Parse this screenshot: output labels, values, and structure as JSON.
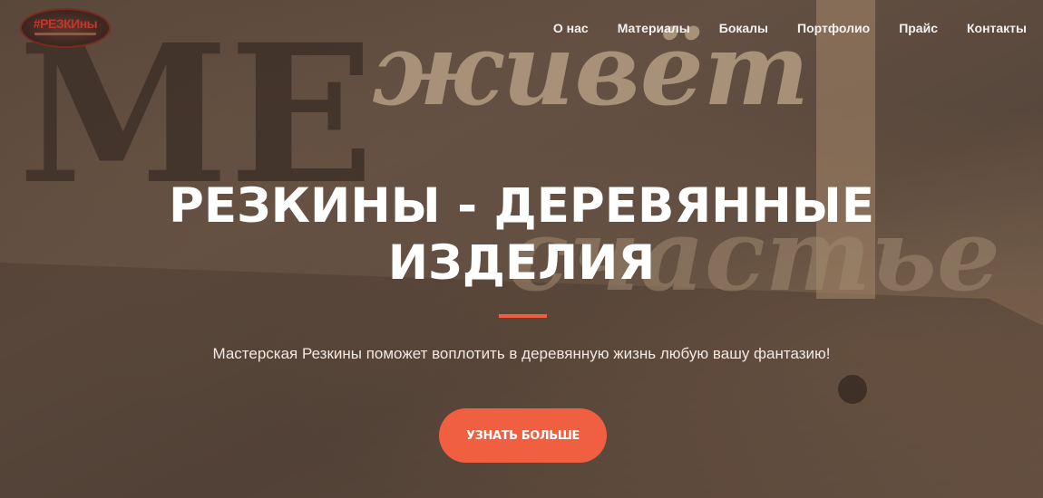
{
  "nav": {
    "items": [
      {
        "label": "О нас"
      },
      {
        "label": "Материалы"
      },
      {
        "label": "Бокалы"
      },
      {
        "label": "Портфолио"
      },
      {
        "label": "Прайс"
      },
      {
        "label": "Контакты"
      }
    ]
  },
  "logo": {
    "text": "#РЕЗКИны"
  },
  "hero": {
    "title_line1": "Резкины - деревянные",
    "title_line2": "изделия",
    "subtitle": "Мастерская Резкины поможет воплотить в деревянную жизнь любую вашу фантазию!",
    "cta_label": "УЗНАТЬ БОЛЬШЕ",
    "background_decor": {
      "word1": "живёт",
      "word2": "счастье",
      "letters": "МЕ"
    }
  },
  "colors": {
    "accent": "#f05f40",
    "text": "#ffffff"
  }
}
